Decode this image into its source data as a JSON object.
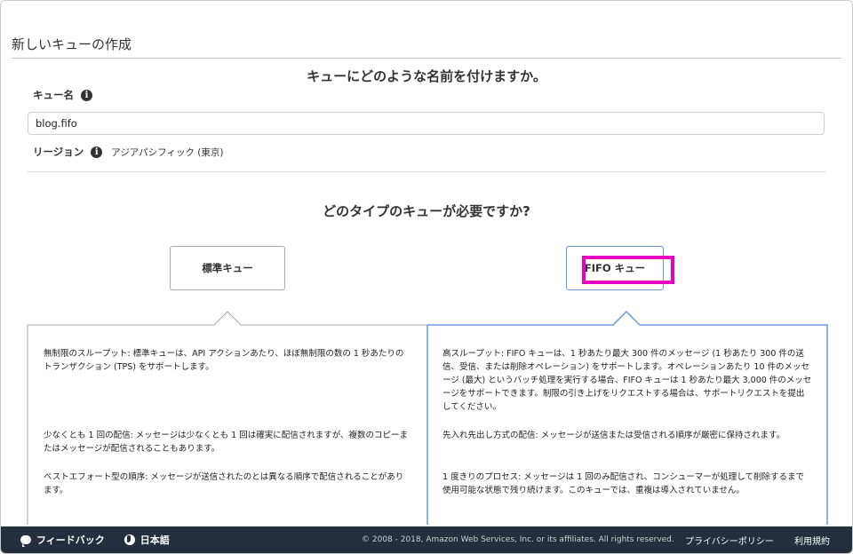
{
  "page_title": "新しいキューの作成",
  "question_name": "キューにどのような名前を付けますか。",
  "queue_name_label": "キュー名",
  "queue_name_value": "blog.fifo",
  "region_label": "リージョン",
  "region_value": "アジアパシフィック (東京)",
  "question_type": "どのタイプのキューが必要ですか?",
  "types": {
    "standard_label": "標準キュー",
    "fifo_label": "FIFO キュー"
  },
  "standard_desc": [
    "無制限のスループット: 標準キューは、API アクションあたり、ほぼ無制限の数の 1 秒あたりのトランザクション (TPS) をサポートします。",
    "少なくとも 1 回の配信: メッセージは少なくとも 1 回は確実に配信されますが、複数のコピーまたはメッセージが配信されることもあります。",
    "ベストエフォート型の順序: メッセージが送信されたのとは異なる順序で配信されることがあります。"
  ],
  "fifo_desc": [
    "高スループット: FIFO キューは、1 秒あたり最大 300 件のメッセージ (1 秒あたり 300 件の送信、受信、または削除オペレーション) をサポートします。オペレーションあたり 10 件のメッセージ (最大) というバッチ処理を実行する場合、FIFO キューは 1 秒あたり最大 3,000 件のメッセージをサポートできます。制限の引き上げをリクエストする場合は、サポートリクエストを提出してください。",
    "先入れ先出し方式の配信: メッセージが送信または受信される順序が厳密に保持されます。",
    "1 度きりのプロセス: メッセージは 1 回のみ配信され、コンシューマーが処理して削除するまで使用可能な状態で残り続けます。このキューでは、重複は導入されていません。"
  ],
  "footer": {
    "feedback": "フィードバック",
    "language": "日本語",
    "copyright": "© 2008 - 2018, Amazon Web Services, Inc. or its affiliates. All rights reserved.",
    "privacy": "プライバシーポリシー",
    "terms": "利用規約"
  },
  "colors": {
    "selected_border": "#6a98d6",
    "highlight": "#e600c4",
    "footer_bg": "#232f3e"
  }
}
